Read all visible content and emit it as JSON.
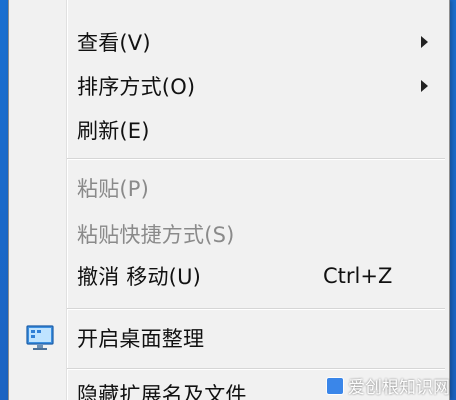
{
  "menu": {
    "items": [
      {
        "label": "查看(V)",
        "has_submenu": true,
        "enabled": true
      },
      {
        "label": "排序方式(O)",
        "has_submenu": true,
        "enabled": true
      },
      {
        "label": "刷新(E)",
        "has_submenu": false,
        "enabled": true
      },
      {
        "label": "粘贴(P)",
        "has_submenu": false,
        "enabled": false
      },
      {
        "label": "粘贴快捷方式(S)",
        "has_submenu": false,
        "enabled": false
      },
      {
        "label": "撤消 移动(U)",
        "shortcut": "Ctrl+Z",
        "has_submenu": false,
        "enabled": true
      },
      {
        "label": "开启桌面整理",
        "icon": "monitor-icon",
        "has_submenu": false,
        "enabled": true
      },
      {
        "label": "隐藏扩展名及文件",
        "has_submenu": false,
        "enabled": true
      }
    ]
  },
  "watermark": {
    "text": "爱创根知识网"
  },
  "colors": {
    "menu_background": "#f1f1f1",
    "disabled_text": "#8a8a8a",
    "desktop_blue": "#1565c0"
  }
}
